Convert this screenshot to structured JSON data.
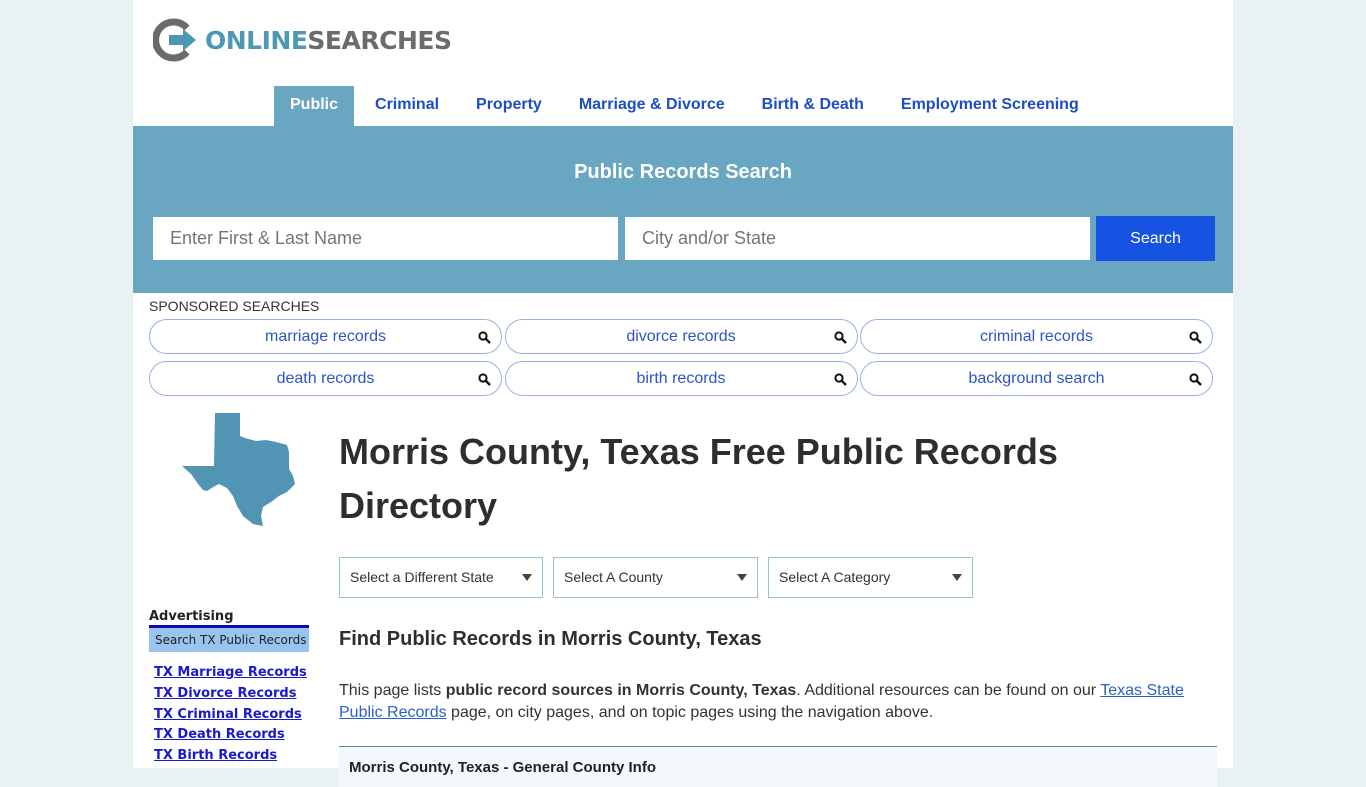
{
  "brand": {
    "logo_word1": "ONLINE",
    "logo_word2": "SEARCHES",
    "colors": {
      "primary": "#68a6c1",
      "link": "#1d4ec3",
      "button": "#1653e3",
      "logo_gray": "#6b6b6b",
      "logo_blue": "#4e97b5"
    }
  },
  "nav": {
    "items": [
      {
        "label": "Public",
        "active": true
      },
      {
        "label": "Criminal",
        "active": false
      },
      {
        "label": "Property",
        "active": false
      },
      {
        "label": "Marriage & Divorce",
        "active": false
      },
      {
        "label": "Birth & Death",
        "active": false
      },
      {
        "label": "Employment Screening",
        "active": false
      }
    ]
  },
  "hero": {
    "title": "Public Records Search",
    "name_placeholder": "Enter First & Last Name",
    "name_value": "",
    "location_placeholder": "City and/or State",
    "location_value": "",
    "search_label": "Search"
  },
  "sponsored": {
    "label": "SPONSORED SEARCHES",
    "items": [
      {
        "label": "marriage records",
        "icon": "search-icon"
      },
      {
        "label": "divorce records",
        "icon": "search-icon"
      },
      {
        "label": "criminal records",
        "icon": "search-icon"
      },
      {
        "label": "death records",
        "icon": "search-icon"
      },
      {
        "label": "birth records",
        "icon": "search-icon"
      },
      {
        "label": "background search",
        "icon": "search-icon"
      }
    ]
  },
  "main": {
    "state_map_icon": "texas-map-icon",
    "title": "Morris County, Texas Free Public Records Directory",
    "selects": [
      {
        "selected": "Select a Different State"
      },
      {
        "selected": "Select A County"
      },
      {
        "selected": "Select A Category"
      }
    ],
    "subtitle": "Find Public Records in Morris County, Texas",
    "intro": {
      "before": "This page lists ",
      "bold": "public record sources in Morris County, Texas",
      "middle": ". Additional resources can be found on our ",
      "link": "Texas State Public Records",
      "after": " page, on city pages, and on topic pages using the navigation above."
    },
    "section_title": "Morris County, Texas - General County Info"
  },
  "sidebar": {
    "advertising_label": "Advertising",
    "box_title": "Search TX Public Records",
    "links": [
      "TX Marriage Records",
      "TX Divorce Records",
      "TX Criminal Records",
      "TX Death Records",
      "TX Birth Records"
    ]
  }
}
